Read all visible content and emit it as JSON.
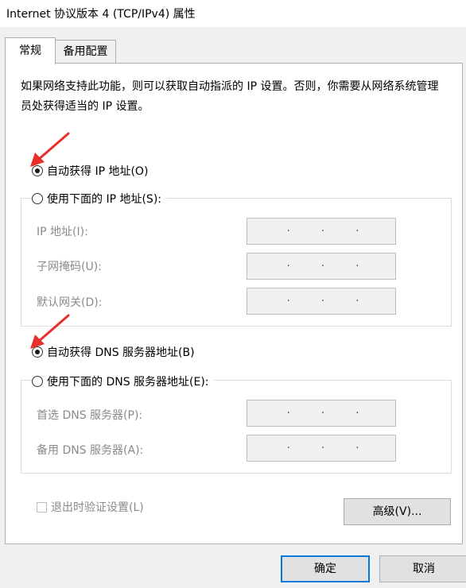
{
  "window": {
    "title": "Internet 协议版本 4 (TCP/IPv4) 属性"
  },
  "tabs": [
    {
      "label": "常规"
    },
    {
      "label": "备用配置"
    }
  ],
  "description": "如果网络支持此功能，则可以获取自动指派的 IP 设置。否则，你需要从网络系统管理员处获得适当的 IP 设置。",
  "ip": {
    "auto_label": "自动获得 IP 地址(O)",
    "manual_label": "使用下面的 IP 地址(S):",
    "address_label": "IP 地址(I):",
    "subnet_label": "子网掩码(U):",
    "gateway_label": "默认网关(D):",
    "selected": "auto"
  },
  "dns": {
    "auto_label": "自动获得 DNS 服务器地址(B)",
    "manual_label": "使用下面的 DNS 服务器地址(E):",
    "preferred_label": "首选 DNS 服务器(P):",
    "alternate_label": "备用 DNS 服务器(A):",
    "selected": "auto"
  },
  "validate_label": "退出时验证设置(L)",
  "buttons": {
    "advanced": "高级(V)...",
    "ok": "确定",
    "cancel": "取消"
  },
  "colors": {
    "annotation_arrow": "#e8302a",
    "default_button_border": "#0078d7"
  }
}
